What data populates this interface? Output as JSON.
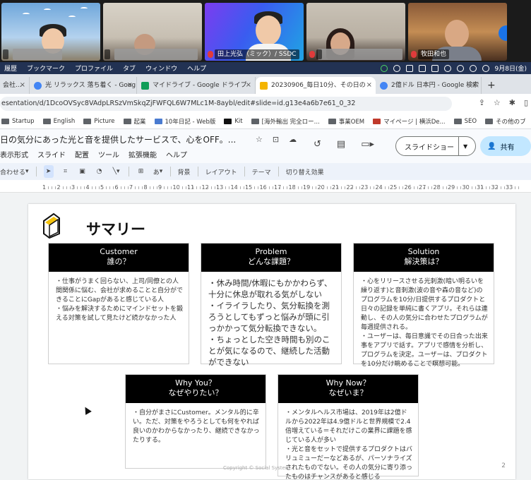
{
  "meeting": {
    "participants": [
      {
        "name": ""
      },
      {
        "name": ""
      },
      {
        "name": "田上光弘（ミック）/ SSDC"
      },
      {
        "name": ""
      },
      {
        "name": "牧田和也"
      }
    ]
  },
  "menubar": {
    "items": [
      "履歴",
      "ブックマーク",
      "プロファイル",
      "タブ",
      "ウィンドウ",
      "ヘルプ"
    ],
    "clock": "9月8日(金)"
  },
  "tabs": [
    {
      "label": "会社...",
      "favicon_color": "#f4b400"
    },
    {
      "label": "光 リラックス 落ち着く - Goog",
      "favicon_color": "#4285f4"
    },
    {
      "label": "マイドライブ - Google ドライブ",
      "favicon_color": "#0f9d58"
    },
    {
      "label": "20230906_毎日10分、その日の",
      "favicon_color": "#f4b400",
      "active": true
    },
    {
      "label": "2億ドル 日本円 - Google 検索",
      "favicon_color": "#4285f4"
    }
  ],
  "address": {
    "url": "esentation/d/1DcoOVSyc8VAdpLRSzVmSkqZjFWFQL6W7MLc1M-8aybl/edit#slide=id.g13e4a6b7e61_0_32"
  },
  "bookmarks": [
    {
      "label": "Startup",
      "icon": "folder-icon"
    },
    {
      "label": "English",
      "icon": "folder-icon"
    },
    {
      "label": "Picture",
      "icon": "folder-icon"
    },
    {
      "label": "起業",
      "icon": "folder-icon"
    },
    {
      "label": "10年日記 - Web版",
      "icon": "page-icon"
    },
    {
      "label": "Kit",
      "icon": "k-icon"
    },
    {
      "label": "[海外輸出 完全ロー...",
      "icon": "folder-icon"
    },
    {
      "label": "事業OEM",
      "icon": "folder-icon"
    },
    {
      "label": "マイページ | 横浜De...",
      "icon": "page-icon"
    },
    {
      "label": "SEO",
      "icon": "folder-icon"
    },
    {
      "label": "その他のブ",
      "icon": "folder-icon"
    }
  ],
  "doc": {
    "title": "日の気分にあった光と音を提供したサービスで、心をOFF。...",
    "menu": [
      "表示形式",
      "スライド",
      "配置",
      "ツール",
      "拡張機能",
      "ヘルプ"
    ],
    "slideshow_label": "スライドショー",
    "share_label": "共有"
  },
  "toolbar": {
    "zoom_label": "合わせる",
    "background_label": "背景",
    "layout_label": "レイアウト",
    "theme_label": "テーマ",
    "transition_label": "切り替え効果",
    "text_style_label": "あ"
  },
  "ruler": {
    "labels": [
      "1",
      "2",
      "3",
      "4",
      "5",
      "6",
      "7",
      "8",
      "9",
      "10",
      "11",
      "12",
      "13",
      "14",
      "15",
      "16",
      "17",
      "18",
      "19",
      "20",
      "21",
      "22",
      "23",
      "24",
      "25",
      "26",
      "27",
      "28",
      "29",
      "30",
      "31",
      "32",
      "33"
    ]
  },
  "slide": {
    "title": "サマリー",
    "page_number": "2",
    "copyright": "Copyright © Social System...",
    "cards": [
      {
        "heading_en": "Customer",
        "heading_ja": "誰の？",
        "body": "・仕事がうまく回らない、上司/同僚との人間関係に悩む、会社が求めることと自分ができることにGapがあると感じている人\n・悩みを解決するためにマインドセットを鍛える対策を試して見たけど続かなかった人"
      },
      {
        "heading_en": "Problem",
        "heading_ja": "どんな課題？",
        "body": "・休み時間/休暇にもかかわらず、十分に休息が取れる気がしない\n・イライラしたり、気分転換を測ろうとしてもずっと悩みが頭に引っかかって気分転換できない。\n・ちょっとした空き時間も別のことが気になるので、継続した活動ができない"
      },
      {
        "heading_en": "Solution",
        "heading_ja": "解決策は？",
        "body": "・心をリリースさせる光刺激(暗い明るいを繰り返す)と音刺激(波の音や森の音など)のプログラムを10分/日提供するプロダクトと日々の記録を単純に書くアプリ。それらは連動し、その人の気分に合わせたプログラムが毎週提供される。\n・ユーザーは、毎日意識でその日合った出来事をアプリで話す。アプリで感情を分析し、プログラムを決定。ユーザーは、プロダクトを10分だけ眺めることで瞑想可能。"
      },
      {
        "heading_en": "Why You？",
        "heading_ja": "なぜやりたい？",
        "body": "・自分がまさにCustomer。メンタル的に辛い。ただ、対策をやろうとしても何をやれば良いのかわからなかったり、継続できなかったりする。"
      },
      {
        "heading_en": "Why Now？",
        "heading_ja": "なぜいま？",
        "body": "・メンタルヘルス市場は、2019年は2億ドルから2022年は4.9億ドルと世界規模で2.4倍増えている＝それだけこの業界に課題を感じている人が多い\n・光と音をセットで提供するプロダクトはバリュミューだーなどあるが、パーソナライズされたものでない。その人の気分に寄り添ったものはチャンスがあると感じる"
      }
    ]
  }
}
